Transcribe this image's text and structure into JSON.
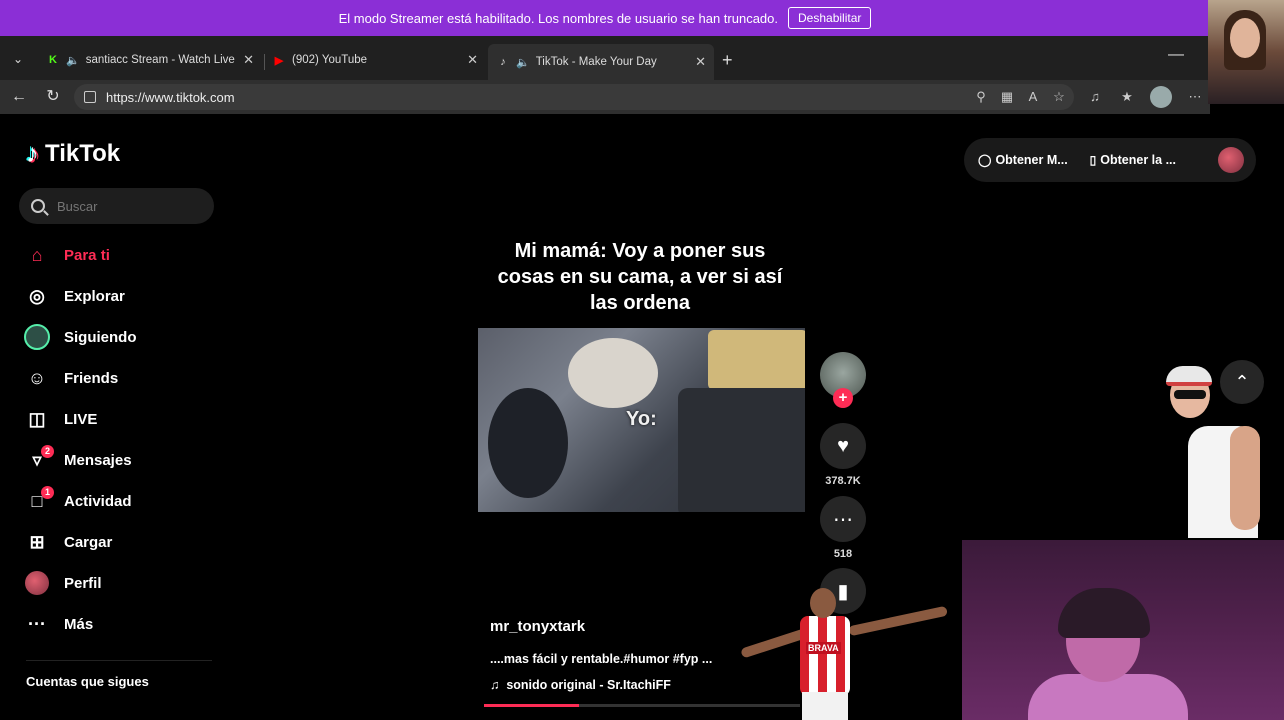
{
  "banner": {
    "message": "El modo Streamer está habilitado. Los nombres de usuario se han truncado.",
    "button": "Deshabilitar"
  },
  "tabs": [
    {
      "title": "santiacc Stream - Watch Live o",
      "favicon": "K",
      "favicon_color": "#53fc18",
      "audio": true
    },
    {
      "title": "(902) YouTube",
      "favicon": "▶",
      "favicon_color": "#ff0000",
      "audio": false
    },
    {
      "title": "TikTok - Make Your Day",
      "favicon": "♪",
      "favicon_color": "#ffffff",
      "audio": true,
      "active": true
    }
  ],
  "address": {
    "url": "https://www.tiktok.com"
  },
  "tiktok": {
    "logo_text": "TikTok",
    "search_placeholder": "Buscar",
    "nav": [
      {
        "label": "Para ti",
        "icon": "home-icon",
        "active": true
      },
      {
        "label": "Explorar",
        "icon": "compass-icon"
      },
      {
        "label": "Siguiendo",
        "icon": "following-avatar-icon"
      },
      {
        "label": "Friends",
        "icon": "friends-icon"
      },
      {
        "label": "LIVE",
        "icon": "live-tv-icon"
      },
      {
        "label": "Mensajes",
        "icon": "send-icon",
        "badge": "2"
      },
      {
        "label": "Actividad",
        "icon": "activity-icon",
        "badge": "1"
      },
      {
        "label": "Cargar",
        "icon": "upload-plus-icon"
      },
      {
        "label": "Perfil",
        "icon": "profile-avatar-icon"
      },
      {
        "label": "Más",
        "icon": "more-dots-icon"
      }
    ],
    "following_title": "Cuentas que sigues",
    "top_actions": {
      "get_coins": "Obtener M...",
      "get_app": "Obtener la ..."
    },
    "video": {
      "caption": "Mi mamá: Voy a poner sus cosas en su cama, a ver si así las ordena",
      "overlay_text": "Yo:",
      "likes": "378.7K",
      "comments": "518",
      "author": "mr_tonyxtark",
      "description": "....mas fácil y rentable.#humor #fyp ...",
      "sound": "sonido original - Sr.ItachiFF",
      "progress_percent": 30
    }
  },
  "stickers": {
    "player_jersey_text": "BRAVA"
  }
}
